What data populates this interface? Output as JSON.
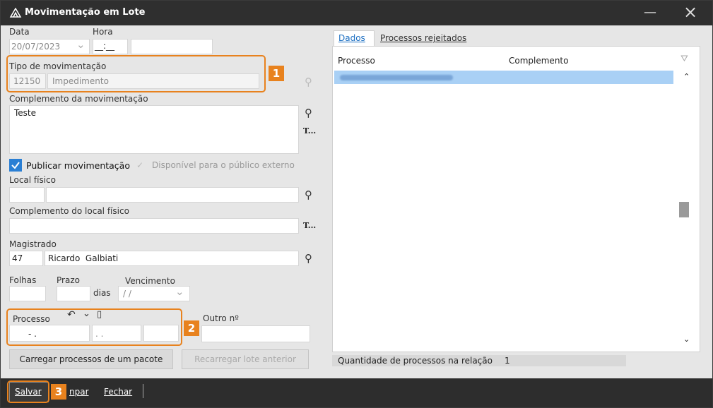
{
  "title": "Movimentação em Lote",
  "date": {
    "label": "Data",
    "value": "20/07/2023"
  },
  "time": {
    "label": "Hora",
    "value": "__:__"
  },
  "tipo": {
    "label": "Tipo de movimentação",
    "code": "12150",
    "text": "Impedimento"
  },
  "complemento": {
    "label": "Complemento da movimentação",
    "value": "Teste"
  },
  "publicar": {
    "label": "Publicar movimentação",
    "checked": true
  },
  "disponivel": {
    "label": "Disponível para o público externo"
  },
  "local": {
    "label": "Local físico"
  },
  "complemento_local": {
    "label": "Complemento do local físico"
  },
  "magistrado": {
    "label": "Magistrado",
    "code": "47",
    "name": "Ricardo  Galbiati"
  },
  "folhas": {
    "label": "Folhas"
  },
  "prazo": {
    "label": "Prazo",
    "unit": "dias"
  },
  "vencimento": {
    "label": "Vencimento",
    "value": "/ /"
  },
  "processo": {
    "label": "Processo",
    "part1": "- .",
    "part2": ". .",
    "outro_label": "Outro nº"
  },
  "buttons": {
    "carregar": "Carregar processos de um pacote",
    "recarregar": "Recarregar lote anterior"
  },
  "tabs": {
    "dados": "Dados",
    "rejeitados": "Processos rejeitados"
  },
  "table": {
    "col1": "Processo",
    "col2": "Complemento"
  },
  "quantidade": {
    "label": "Quantidade de processos na relação",
    "value": "1"
  },
  "footer": {
    "salvar": "Salvar",
    "limpar": "npar",
    "fechar": "Fechar"
  },
  "badges": {
    "b1": "1",
    "b2": "2",
    "b3": "3"
  },
  "icons": {
    "t_icon": "T..."
  }
}
